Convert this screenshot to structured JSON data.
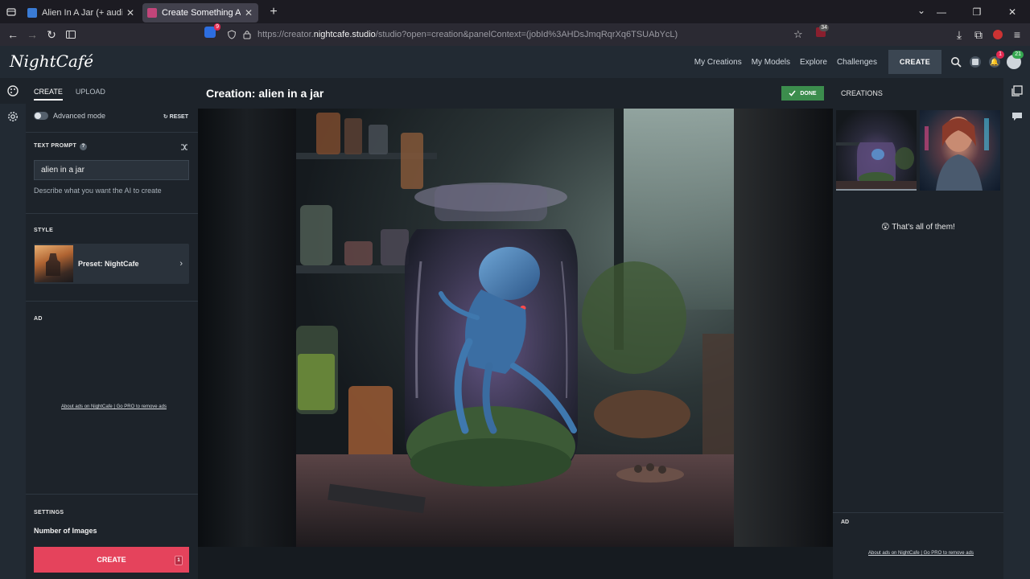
{
  "browser": {
    "tabs": [
      {
        "title": "Alien In A Jar (+ audiosex comr",
        "active": false,
        "favicon_color": "#3a7bd5"
      },
      {
        "title": "Create Something Amazing - N",
        "active": true,
        "favicon_color": "#c2457a"
      }
    ],
    "url_prefix": "https://creator.",
    "url_domain": "nightcafe.studio",
    "url_suffix": "/studio?open=creation&panelContext=(jobId%3AHDsJmqRqrXq6TSUAbYcL)",
    "extension_badge_1": "9",
    "extension_badge_2": "34"
  },
  "site": {
    "logo": "NightCafé",
    "nav": [
      "My Creations",
      "My Models",
      "Explore",
      "Challenges"
    ],
    "create_label": "CREATE",
    "notification_count": "1",
    "profile_count": "21"
  },
  "left_panel": {
    "tabs": [
      "CREATE",
      "UPLOAD"
    ],
    "advanced_mode_label": "Advanced mode",
    "reset_label": "RESET",
    "text_prompt_label": "TEXT PROMPT",
    "prompt_value": "alien in a jar",
    "prompt_hint": "Describe what you want the AI to create",
    "style_label": "STYLE",
    "style_preset": "Preset: NightCafe",
    "ad_label": "AD",
    "ad_links": "About ads on NightCafe | Go PRO to remove ads",
    "settings_label": "SETTINGS",
    "number_of_images_label": "Number of Images",
    "create_button": "CREATE",
    "create_count": "1"
  },
  "center": {
    "title": "Creation: alien in a jar",
    "status": "DONE"
  },
  "right_panel": {
    "creations_label": "CREATIONS",
    "all_of_them": "That's all of them!",
    "ad_label": "AD",
    "ad_links": "About ads on NightCafe | Go PRO to remove ads"
  },
  "colors": {
    "accent": "#e5435c",
    "done_green": "#3c8d4d",
    "panel_bg": "#1d232a",
    "header_bg": "#222a33"
  }
}
